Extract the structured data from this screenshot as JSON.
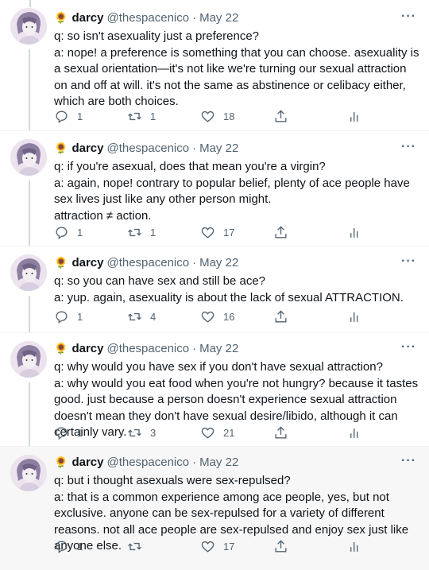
{
  "tweets": [
    {
      "name": "darcy",
      "handle": "@thespacenico",
      "sep": "·",
      "date": "May 22",
      "more": "···",
      "text": "q: so isn't asexuality just a preference?\na: nope! a preference is something that you can choose. asexuality is a sexual orientation—it's not like we're turning our sexual attraction on and off at will. it's not the same as abstinence or celibacy either, which are both choices.",
      "replies": "1",
      "retweets": "1",
      "likes": "18"
    },
    {
      "name": "darcy",
      "handle": "@thespacenico",
      "sep": "·",
      "date": "May 22",
      "more": "···",
      "text": "q: if you're asexual, does that mean you're a virgin?\na: again, nope! contrary to popular belief, plenty of ace people have sex lives just like any other person might.\nattraction ≠ action.",
      "replies": "1",
      "retweets": "1",
      "likes": "17"
    },
    {
      "name": "darcy",
      "handle": "@thespacenico",
      "sep": "·",
      "date": "May 22",
      "more": "···",
      "text": "q: so you can have sex and still be ace?\na: yup. again, asexuality is about the lack of sexual ATTRACTION.",
      "replies": "1",
      "retweets": "4",
      "likes": "16"
    },
    {
      "name": "darcy",
      "handle": "@thespacenico",
      "sep": "·",
      "date": "May 22",
      "more": "···",
      "text": "q: why would you have sex if you don't have sexual attraction?\na: why would you eat food when you're not hungry? because it tastes good. just because a person doesn't experience sexual attraction doesn't mean they don't have sexual desire/libido, although it can certainly vary.",
      "replies": "1",
      "retweets": "3",
      "likes": "21"
    },
    {
      "name": "darcy",
      "handle": "@thespacenico",
      "sep": "·",
      "date": "May 22",
      "more": "···",
      "text": "q: but i thought asexuals were sex-repulsed?\na: that is a common experience among ace people, yes, but not exclusive. anyone can be sex-repulsed for a variety of different reasons. not all ace people are sex-repulsed and enjoy sex just like anyone else.",
      "replies": "1",
      "retweets": "",
      "likes": "17"
    }
  ],
  "colors": {
    "text": "#0f1419",
    "muted": "#536471",
    "thread_line": "#cfd9de",
    "highlight_bg": "#f7f7f7"
  },
  "icons": [
    "sunflower-emoji",
    "reply-icon",
    "retweet-icon",
    "like-icon",
    "share-icon",
    "stats-icon",
    "more-icon"
  ]
}
